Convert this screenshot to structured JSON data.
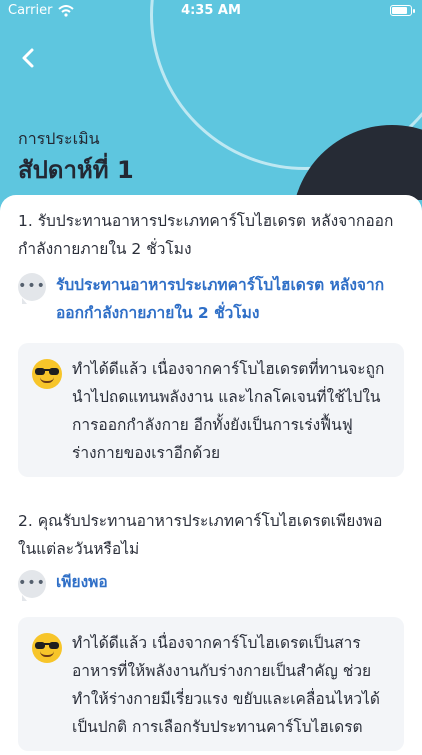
{
  "status": {
    "carrier": "Carrier",
    "time": "4:35 AM"
  },
  "header": {
    "subtitle": "การประเมิน",
    "title": "สัปดาห์ที่ 1"
  },
  "questions": [
    {
      "question": "1. รับประทานอาหารประเภทคาร์โบไฮเดรต หลังจากออกกำลังกายภายใน 2 ชั่วโมง",
      "answer": "รับประทานอาหารประเภทคาร์โบไฮเดรต หลังจากออกกำลังกายภายใน 2 ชั่วโมง",
      "feedback": "ทำได้ดีแล้ว เนื่องจากคาร์โบไฮเดรตที่ทานจะถูกนำไปถดแทนพลังงาน และไกลโคเจนที่ใช้ไปในการออกกำลังกาย อีกทั้งยังเป็นการเร่งฟื้นฟูร่างกายของเราอีกด้วย"
    },
    {
      "question": "2. คุณรับประทานอาหารประเภทคาร์โบไฮเดรตเพียงพอในแต่ละวันหรือไม่",
      "answer": "เพียงพอ",
      "feedback": "ทำได้ดีแล้ว เนื่องจากคาร์โบไฮเดรตเป็นสารอาหารที่ให้พลังงานกับร่างกายเป็นสำคัญ ช่วยทำให้ร่างกายมีเรี่ยวแรง ขยับและเคลื่อนไหวได้เป็นปกติ การเลือกรับประทานคาร์โบไฮเดรต"
    }
  ],
  "icons": {
    "back": "chevron-left-icon",
    "answer": "chat-bubble-icon",
    "feedback": "sunglasses-emoji-icon",
    "wifi": "wifi-icon",
    "battery": "battery-icon"
  },
  "colors": {
    "header_bg": "#5ec6df",
    "accent": "#2f6fc7",
    "dark_circle": "#262b35",
    "card_bg": "#f3f5f8"
  }
}
